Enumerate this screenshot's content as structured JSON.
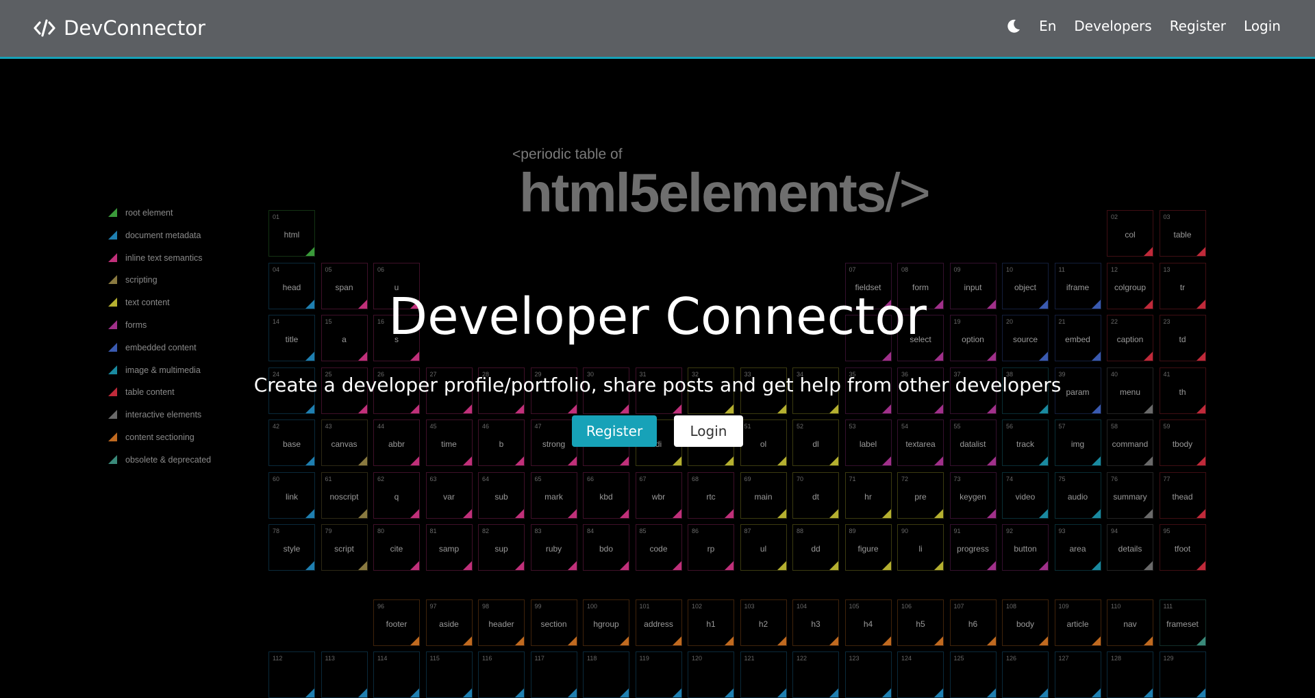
{
  "navbar": {
    "brand": "DevConnector",
    "language": "En",
    "links": {
      "developers": "Developers",
      "register": "Register",
      "login": "Login"
    }
  },
  "hero": {
    "title": "Developer Connector",
    "lead": "Create a developer profile/portfolio, share posts and get help from other developers",
    "register_button": "Register",
    "login_button": "Login"
  },
  "background": {
    "heading_small": "<periodic table of",
    "heading_big": "html5elements",
    "heading_close": "/>",
    "legend": [
      {
        "label": "root element",
        "color": "#3a9a3a"
      },
      {
        "label": "document metadata",
        "color": "#1f7fb0"
      },
      {
        "label": "inline text semantics",
        "color": "#c0307a"
      },
      {
        "label": "scripting",
        "color": "#8a7a40"
      },
      {
        "label": "text content",
        "color": "#b5b030"
      },
      {
        "label": "forms",
        "color": "#a0308a"
      },
      {
        "label": "embedded content",
        "color": "#3a5ab0"
      },
      {
        "label": "image & multimedia",
        "color": "#1a8aa0"
      },
      {
        "label": "table content",
        "color": "#c02a3a"
      },
      {
        "label": "interactive elements",
        "color": "#6a6a6a"
      },
      {
        "label": "content sectioning",
        "color": "#c06a20"
      },
      {
        "label": "obsolete & deprecated",
        "color": "#3a8a7a"
      }
    ],
    "tiles": [
      {
        "n": "01",
        "s": "html",
        "c": 0,
        "col": 0,
        "row": 0
      },
      {
        "n": "02",
        "s": "col",
        "c": 8,
        "col": 16,
        "row": 0
      },
      {
        "n": "03",
        "s": "table",
        "c": 8,
        "col": 17,
        "row": 0
      },
      {
        "n": "04",
        "s": "head",
        "c": 1,
        "col": 0,
        "row": 1
      },
      {
        "n": "05",
        "s": "span",
        "c": 2,
        "col": 1,
        "row": 1
      },
      {
        "n": "06",
        "s": "u",
        "c": 2,
        "col": 2,
        "row": 1
      },
      {
        "n": "07",
        "s": "fieldset",
        "c": 5,
        "col": 11,
        "row": 1
      },
      {
        "n": "08",
        "s": "form",
        "c": 5,
        "col": 12,
        "row": 1
      },
      {
        "n": "09",
        "s": "input",
        "c": 5,
        "col": 13,
        "row": 1
      },
      {
        "n": "10",
        "s": "object",
        "c": 6,
        "col": 14,
        "row": 1
      },
      {
        "n": "11",
        "s": "iframe",
        "c": 6,
        "col": 15,
        "row": 1
      },
      {
        "n": "12",
        "s": "colgroup",
        "c": 8,
        "col": 16,
        "row": 1
      },
      {
        "n": "13",
        "s": "tr",
        "c": 8,
        "col": 17,
        "row": 1
      },
      {
        "n": "14",
        "s": "title",
        "c": 1,
        "col": 0,
        "row": 2
      },
      {
        "n": "15",
        "s": "a",
        "c": 2,
        "col": 1,
        "row": 2
      },
      {
        "n": "16",
        "s": "s",
        "c": 2,
        "col": 2,
        "row": 2
      },
      {
        "n": "",
        "s": "",
        "c": 5,
        "col": 11,
        "row": 2
      },
      {
        "n": "",
        "s": "select",
        "c": 5,
        "col": 12,
        "row": 2
      },
      {
        "n": "19",
        "s": "option",
        "c": 5,
        "col": 13,
        "row": 2
      },
      {
        "n": "20",
        "s": "source",
        "c": 6,
        "col": 14,
        "row": 2
      },
      {
        "n": "21",
        "s": "embed",
        "c": 6,
        "col": 15,
        "row": 2
      },
      {
        "n": "22",
        "s": "caption",
        "c": 8,
        "col": 16,
        "row": 2
      },
      {
        "n": "23",
        "s": "td",
        "c": 8,
        "col": 17,
        "row": 2
      },
      {
        "n": "24",
        "s": "",
        "c": 1,
        "col": 0,
        "row": 3
      },
      {
        "n": "25",
        "s": "",
        "c": 2,
        "col": 1,
        "row": 3
      },
      {
        "n": "26",
        "s": "",
        "c": 2,
        "col": 2,
        "row": 3
      },
      {
        "n": "27",
        "s": "",
        "c": 2,
        "col": 3,
        "row": 3
      },
      {
        "n": "28",
        "s": "",
        "c": 2,
        "col": 4,
        "row": 3
      },
      {
        "n": "29",
        "s": "",
        "c": 2,
        "col": 5,
        "row": 3
      },
      {
        "n": "30",
        "s": "",
        "c": 2,
        "col": 6,
        "row": 3
      },
      {
        "n": "31",
        "s": "",
        "c": 2,
        "col": 7,
        "row": 3
      },
      {
        "n": "32",
        "s": "",
        "c": 4,
        "col": 8,
        "row": 3
      },
      {
        "n": "33",
        "s": "",
        "c": 4,
        "col": 9,
        "row": 3
      },
      {
        "n": "34",
        "s": "",
        "c": 4,
        "col": 10,
        "row": 3
      },
      {
        "n": "35",
        "s": "",
        "c": 5,
        "col": 11,
        "row": 3
      },
      {
        "n": "36",
        "s": "",
        "c": 5,
        "col": 12,
        "row": 3
      },
      {
        "n": "37",
        "s": "",
        "c": 5,
        "col": 13,
        "row": 3
      },
      {
        "n": "38",
        "s": "",
        "c": 7,
        "col": 14,
        "row": 3
      },
      {
        "n": "39",
        "s": "param",
        "c": 6,
        "col": 15,
        "row": 3
      },
      {
        "n": "40",
        "s": "menu",
        "c": 9,
        "col": 16,
        "row": 3
      },
      {
        "n": "41",
        "s": "th",
        "c": 8,
        "col": 17,
        "row": 3
      },
      {
        "n": "42",
        "s": "base",
        "c": 1,
        "col": 0,
        "row": 4
      },
      {
        "n": "43",
        "s": "canvas",
        "c": 3,
        "col": 1,
        "row": 4
      },
      {
        "n": "44",
        "s": "abbr",
        "c": 2,
        "col": 2,
        "row": 4
      },
      {
        "n": "45",
        "s": "time",
        "c": 2,
        "col": 3,
        "row": 4
      },
      {
        "n": "46",
        "s": "b",
        "c": 2,
        "col": 4,
        "row": 4
      },
      {
        "n": "47",
        "s": "strong",
        "c": 2,
        "col": 5,
        "row": 4
      },
      {
        "n": "",
        "s": "",
        "c": 2,
        "col": 6,
        "row": 4
      },
      {
        "n": "",
        "s": "di",
        "c": 4,
        "col": 7,
        "row": 4
      },
      {
        "n": "",
        "s": "",
        "c": 4,
        "col": 8,
        "row": 4
      },
      {
        "n": "51",
        "s": "ol",
        "c": 4,
        "col": 9,
        "row": 4
      },
      {
        "n": "52",
        "s": "dl",
        "c": 4,
        "col": 10,
        "row": 4
      },
      {
        "n": "53",
        "s": "label",
        "c": 5,
        "col": 11,
        "row": 4
      },
      {
        "n": "54",
        "s": "textarea",
        "c": 5,
        "col": 12,
        "row": 4
      },
      {
        "n": "55",
        "s": "datalist",
        "c": 5,
        "col": 13,
        "row": 4
      },
      {
        "n": "56",
        "s": "track",
        "c": 7,
        "col": 14,
        "row": 4
      },
      {
        "n": "57",
        "s": "img",
        "c": 7,
        "col": 15,
        "row": 4
      },
      {
        "n": "58",
        "s": "command",
        "c": 9,
        "col": 16,
        "row": 4
      },
      {
        "n": "59",
        "s": "tbody",
        "c": 8,
        "col": 17,
        "row": 4
      },
      {
        "n": "60",
        "s": "link",
        "c": 1,
        "col": 0,
        "row": 5
      },
      {
        "n": "61",
        "s": "noscript",
        "c": 3,
        "col": 1,
        "row": 5
      },
      {
        "n": "62",
        "s": "q",
        "c": 2,
        "col": 2,
        "row": 5
      },
      {
        "n": "63",
        "s": "var",
        "c": 2,
        "col": 3,
        "row": 5
      },
      {
        "n": "64",
        "s": "sub",
        "c": 2,
        "col": 4,
        "row": 5
      },
      {
        "n": "65",
        "s": "mark",
        "c": 2,
        "col": 5,
        "row": 5
      },
      {
        "n": "66",
        "s": "kbd",
        "c": 2,
        "col": 6,
        "row": 5
      },
      {
        "n": "67",
        "s": "wbr",
        "c": 2,
        "col": 7,
        "row": 5
      },
      {
        "n": "68",
        "s": "rtc",
        "c": 2,
        "col": 8,
        "row": 5
      },
      {
        "n": "69",
        "s": "main",
        "c": 4,
        "col": 9,
        "row": 5
      },
      {
        "n": "70",
        "s": "dt",
        "c": 4,
        "col": 10,
        "row": 5
      },
      {
        "n": "71",
        "s": "hr",
        "c": 4,
        "col": 11,
        "row": 5
      },
      {
        "n": "72",
        "s": "pre",
        "c": 4,
        "col": 12,
        "row": 5
      },
      {
        "n": "73",
        "s": "keygen",
        "c": 5,
        "col": 13,
        "row": 5
      },
      {
        "n": "74",
        "s": "video",
        "c": 7,
        "col": 14,
        "row": 5
      },
      {
        "n": "75",
        "s": "audio",
        "c": 7,
        "col": 15,
        "row": 5
      },
      {
        "n": "76",
        "s": "summary",
        "c": 9,
        "col": 16,
        "row": 5
      },
      {
        "n": "77",
        "s": "thead",
        "c": 8,
        "col": 17,
        "row": 5
      },
      {
        "n": "78",
        "s": "style",
        "c": 1,
        "col": 0,
        "row": 6
      },
      {
        "n": "79",
        "s": "script",
        "c": 3,
        "col": 1,
        "row": 6
      },
      {
        "n": "80",
        "s": "cite",
        "c": 2,
        "col": 2,
        "row": 6
      },
      {
        "n": "81",
        "s": "samp",
        "c": 2,
        "col": 3,
        "row": 6
      },
      {
        "n": "82",
        "s": "sup",
        "c": 2,
        "col": 4,
        "row": 6
      },
      {
        "n": "83",
        "s": "ruby",
        "c": 2,
        "col": 5,
        "row": 6
      },
      {
        "n": "84",
        "s": "bdo",
        "c": 2,
        "col": 6,
        "row": 6
      },
      {
        "n": "85",
        "s": "code",
        "c": 2,
        "col": 7,
        "row": 6
      },
      {
        "n": "86",
        "s": "rp",
        "c": 2,
        "col": 8,
        "row": 6
      },
      {
        "n": "87",
        "s": "ul",
        "c": 4,
        "col": 9,
        "row": 6
      },
      {
        "n": "88",
        "s": "dd",
        "c": 4,
        "col": 10,
        "row": 6
      },
      {
        "n": "89",
        "s": "figure",
        "c": 4,
        "col": 11,
        "row": 6
      },
      {
        "n": "90",
        "s": "li",
        "c": 4,
        "col": 12,
        "row": 6
      },
      {
        "n": "91",
        "s": "progress",
        "c": 5,
        "col": 13,
        "row": 6
      },
      {
        "n": "92",
        "s": "button",
        "c": 5,
        "col": 14,
        "row": 6
      },
      {
        "n": "93",
        "s": "area",
        "c": 7,
        "col": 15,
        "row": 6
      },
      {
        "n": "94",
        "s": "details",
        "c": 9,
        "col": 16,
        "row": 6
      },
      {
        "n": "95",
        "s": "tfoot",
        "c": 8,
        "col": 17,
        "row": 6
      },
      {
        "n": "96",
        "s": "footer",
        "c": 10,
        "col": 2,
        "row": 7
      },
      {
        "n": "97",
        "s": "aside",
        "c": 10,
        "col": 3,
        "row": 7
      },
      {
        "n": "98",
        "s": "header",
        "c": 10,
        "col": 4,
        "row": 7
      },
      {
        "n": "99",
        "s": "section",
        "c": 10,
        "col": 5,
        "row": 7
      },
      {
        "n": "100",
        "s": "hgroup",
        "c": 10,
        "col": 6,
        "row": 7
      },
      {
        "n": "101",
        "s": "address",
        "c": 10,
        "col": 7,
        "row": 7
      },
      {
        "n": "102",
        "s": "h1",
        "c": 10,
        "col": 8,
        "row": 7
      },
      {
        "n": "103",
        "s": "h2",
        "c": 10,
        "col": 9,
        "row": 7
      },
      {
        "n": "104",
        "s": "h3",
        "c": 10,
        "col": 10,
        "row": 7
      },
      {
        "n": "105",
        "s": "h4",
        "c": 10,
        "col": 11,
        "row": 7
      },
      {
        "n": "106",
        "s": "h5",
        "c": 10,
        "col": 12,
        "row": 7
      },
      {
        "n": "107",
        "s": "h6",
        "c": 10,
        "col": 13,
        "row": 7
      },
      {
        "n": "108",
        "s": "body",
        "c": 10,
        "col": 14,
        "row": 7
      },
      {
        "n": "109",
        "s": "article",
        "c": 10,
        "col": 15,
        "row": 7
      },
      {
        "n": "110",
        "s": "nav",
        "c": 10,
        "col": 16,
        "row": 7
      },
      {
        "n": "111",
        "s": "frameset",
        "c": 11,
        "col": 17,
        "row": 7
      },
      {
        "n": "112",
        "s": "",
        "c": 1,
        "col": 0,
        "row": 8
      },
      {
        "n": "113",
        "s": "",
        "c": 1,
        "col": 1,
        "row": 8
      },
      {
        "n": "114",
        "s": "",
        "c": 1,
        "col": 2,
        "row": 8
      },
      {
        "n": "115",
        "s": "",
        "c": 1,
        "col": 3,
        "row": 8
      },
      {
        "n": "116",
        "s": "",
        "c": 1,
        "col": 4,
        "row": 8
      },
      {
        "n": "117",
        "s": "",
        "c": 1,
        "col": 5,
        "row": 8
      },
      {
        "n": "118",
        "s": "",
        "c": 1,
        "col": 6,
        "row": 8
      },
      {
        "n": "119",
        "s": "",
        "c": 1,
        "col": 7,
        "row": 8
      },
      {
        "n": "120",
        "s": "",
        "c": 1,
        "col": 8,
        "row": 8
      },
      {
        "n": "121",
        "s": "",
        "c": 1,
        "col": 9,
        "row": 8
      },
      {
        "n": "122",
        "s": "",
        "c": 1,
        "col": 10,
        "row": 8
      },
      {
        "n": "123",
        "s": "",
        "c": 1,
        "col": 11,
        "row": 8
      },
      {
        "n": "124",
        "s": "",
        "c": 1,
        "col": 12,
        "row": 8
      },
      {
        "n": "125",
        "s": "",
        "c": 1,
        "col": 13,
        "row": 8
      },
      {
        "n": "126",
        "s": "",
        "c": 1,
        "col": 14,
        "row": 8
      },
      {
        "n": "127",
        "s": "",
        "c": 1,
        "col": 15,
        "row": 8
      },
      {
        "n": "128",
        "s": "",
        "c": 1,
        "col": 16,
        "row": 8
      },
      {
        "n": "129",
        "s": "",
        "c": 1,
        "col": 17,
        "row": 8
      }
    ]
  },
  "colors": {
    "accent": "#17a2b8",
    "navbar": "#5c5f63"
  }
}
